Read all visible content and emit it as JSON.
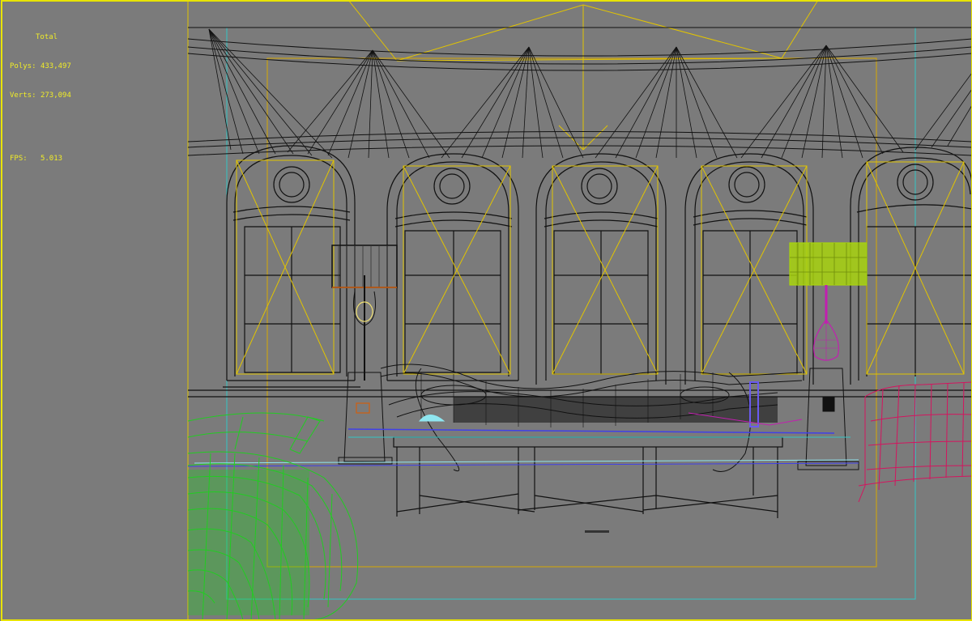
{
  "viewport": {
    "label": "Perspective viewport (wireframe)",
    "background_color": "#7b7b7b",
    "border_color": "#e8e300"
  },
  "stats": {
    "title": "Total",
    "polys_label": "Polys:",
    "polys_value": "433,497",
    "verts_label": "Verts:",
    "verts_value": "273,094",
    "fps_label": "FPS:",
    "fps_value": "5.013"
  },
  "colors": {
    "wire_default": "#111111",
    "wire_selected_frame": "#e2c400",
    "safe_frame": "#33c6c6",
    "chair_green": "#22cc22",
    "sofa_magenta": "#d4155f",
    "lamp_lime": "#a8d40e",
    "lamp_vase": "#c21fb0",
    "accent_blue": "#4040e8",
    "accent_cyan": "#8fe6f0",
    "accent_orange": "#d06010"
  },
  "icons": [
    "fps-counter-icon"
  ]
}
